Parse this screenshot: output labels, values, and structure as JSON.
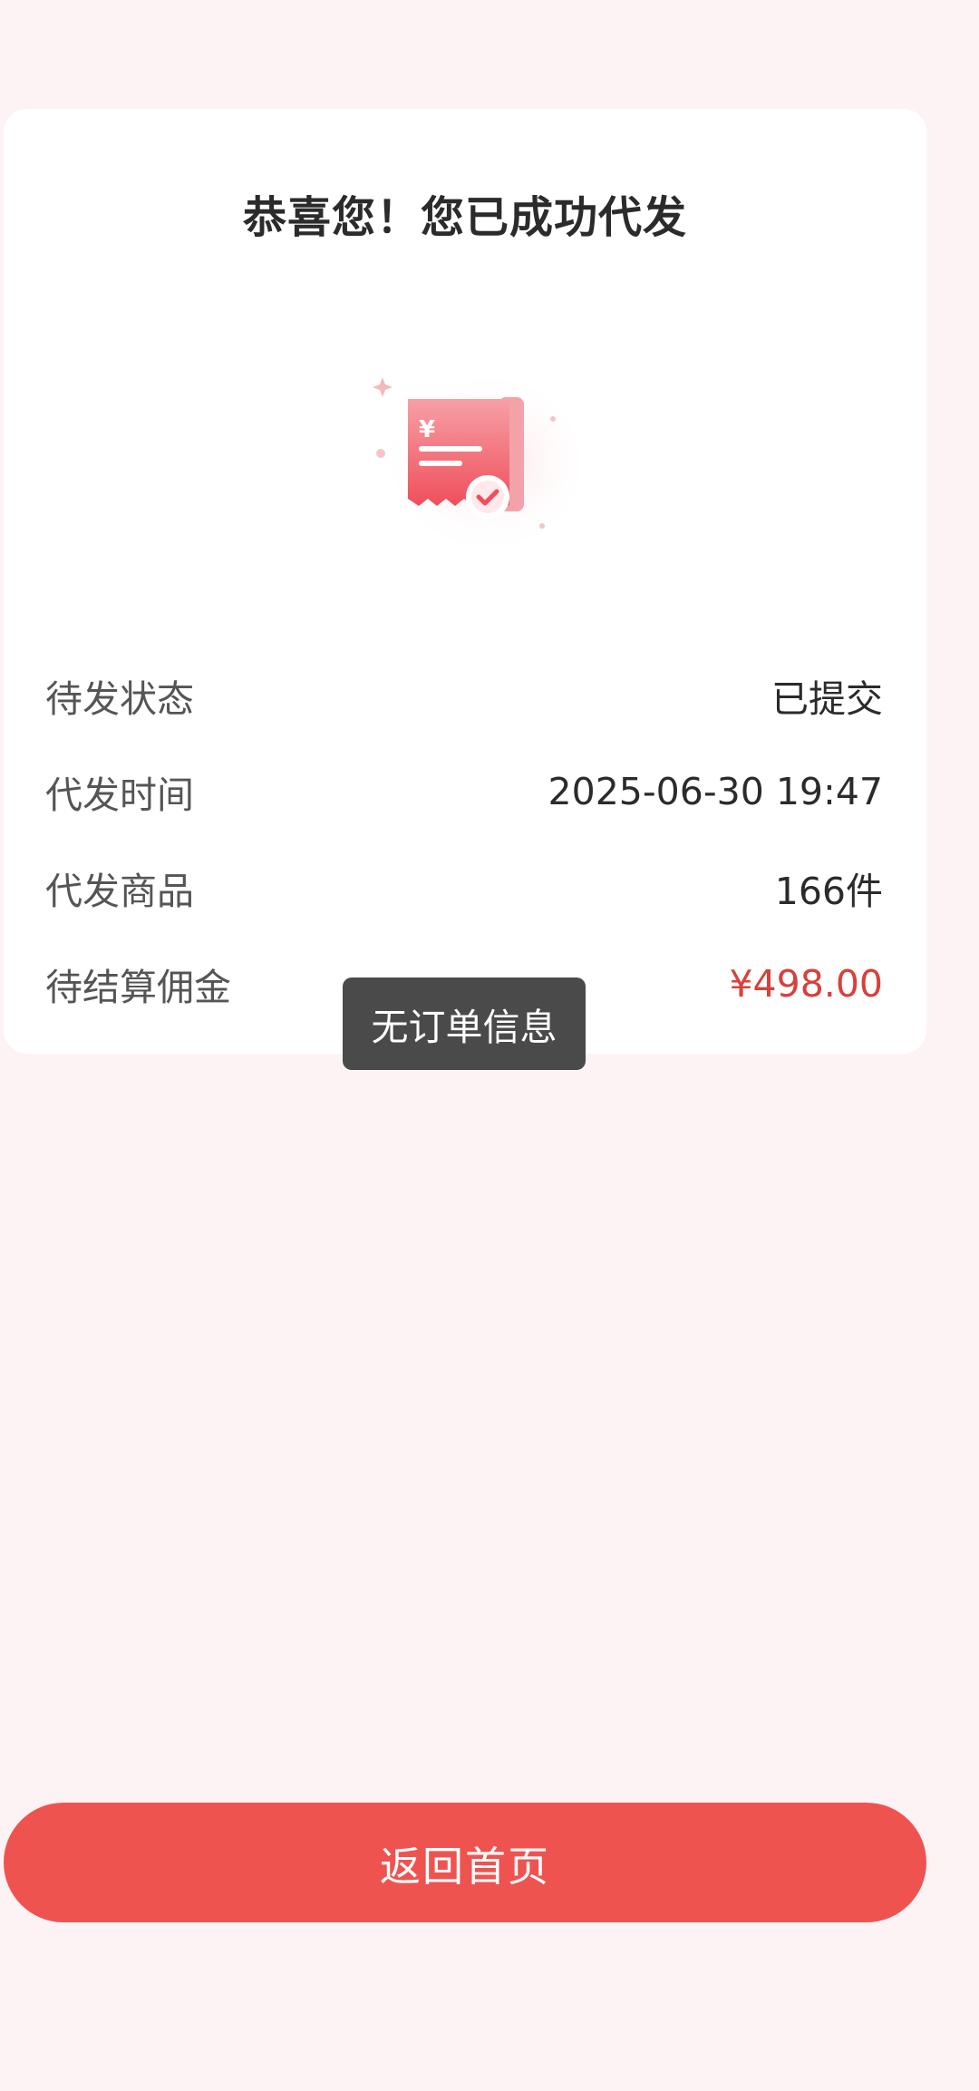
{
  "card": {
    "title": "恭喜您！您已成功代发",
    "illustration_icon": "receipt-check-icon",
    "rows": [
      {
        "label": "待发状态",
        "value": "已提交"
      },
      {
        "label": "代发时间",
        "value": "2025-06-30 19:47"
      },
      {
        "label": "代发商品",
        "value": "166件"
      },
      {
        "label": "待结算佣金",
        "value": "¥498.00"
      }
    ]
  },
  "toast": {
    "text": "无订单信息"
  },
  "footer": {
    "home_button_label": "返回首页"
  },
  "colors": {
    "background": "#fef3f4",
    "accent": "#ef5350",
    "money": "#d9403a",
    "toast_bg": "#4a4a4a"
  }
}
